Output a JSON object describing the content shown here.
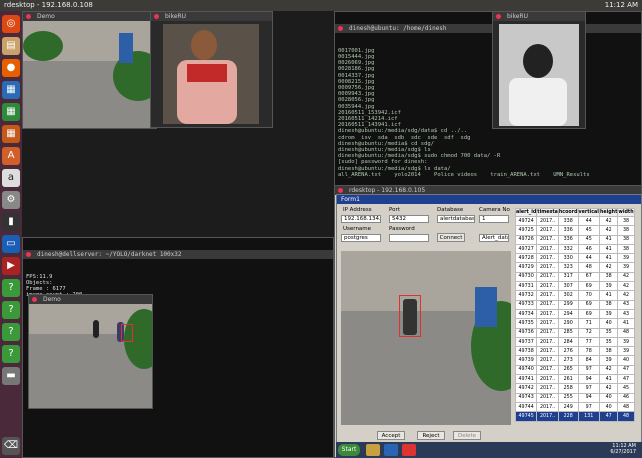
{
  "topbar": {
    "title": "rdesktop - 192.168.0.108",
    "clock": "11:12 AM"
  },
  "win_demo_top": {
    "title": "Demo"
  },
  "win_bikeru_left": {
    "title": "bikeRU"
  },
  "win_bikeru_right": {
    "title": "bikeRU"
  },
  "terminal_top_right": {
    "title": "dinesh@ubuntu: /home/dinesh",
    "lines": [
      "0017001.jpg",
      "0015444.jpg",
      "0026069.jpg",
      "0028186.jpg",
      "0014337.jpg",
      "0008215.jpg",
      "0009756.jpg",
      "0009943.jpg",
      "0028056.jpg",
      "0035944.jpg",
      "20160511_153942.icf",
      "20160511_14214.icf",
      "20160511_143941.icf",
      "dinesh@ubuntu:/media/sdg/data$ cd ../..",
      "cdrom  isv  sda  sdb  sdc  sde  sdf  sdg",
      "dinesh@ubuntu:/media$ cd sdg/",
      "dinesh@ubuntu:/media/sdg$ ls",
      "dinesh@ubuntu:/media/sdg$ sudo chmod 700 data/ -R",
      "[sudo] password for dinesh:",
      "dinesh@ubuntu:/media/sdg$ ls data/",
      "all_ARENA.txt    yolo2014    Police videos    train_ARENA.txt    UMN_Results"
    ]
  },
  "terminal_darknet": {
    "title": "dinesh@dellserver: ~/YOLO/darknet 100x32",
    "lines": [
      "FPS:11.9",
      "Objects:",
      "",
      "Frame : 6177",
      "image_count : 200"
    ]
  },
  "win_demo_bottom": {
    "title": "Demo"
  },
  "form1": {
    "window_title": "rdesktop - 192.168.0.105",
    "title": "Form1",
    "ip_label": "IP Address",
    "ip_value": "192.168.134.5",
    "port_label": "Port",
    "port_value": "5432",
    "db_label": "Database",
    "db_value": "alertdatabase",
    "camera_label": "Camera No",
    "camera_value": "1",
    "user_label": "Username",
    "user_value": "postgres",
    "pass_label": "Password",
    "pass_value": "",
    "connect_label": "Connect",
    "alert_select": "Alert_data▾",
    "accept_label": "Accept",
    "reject_label": "Reject",
    "extra_label": "Delete",
    "grid": {
      "headers": [
        "alert_id",
        "timesta",
        "hcoord",
        "vertical",
        "height",
        "width"
      ],
      "rows": [
        [
          "49724",
          "2017..",
          "338",
          "44",
          "42",
          "38"
        ],
        [
          "49725",
          "2017..",
          "336",
          "45",
          "42",
          "38"
        ],
        [
          "49726",
          "2017..",
          "336",
          "45",
          "41",
          "38"
        ],
        [
          "49727",
          "2017..",
          "332",
          "46",
          "41",
          "38"
        ],
        [
          "49728",
          "2017..",
          "330",
          "44",
          "41",
          "39"
        ],
        [
          "49729",
          "2017..",
          "323",
          "48",
          "42",
          "39"
        ],
        [
          "49730",
          "2017..",
          "317",
          "67",
          "38",
          "42"
        ],
        [
          "49731",
          "2017..",
          "307",
          "69",
          "39",
          "42"
        ],
        [
          "49732",
          "2017..",
          "302",
          "70",
          "41",
          "42"
        ],
        [
          "49733",
          "2017..",
          "299",
          "69",
          "38",
          "43"
        ],
        [
          "49734",
          "2017..",
          "294",
          "69",
          "39",
          "43"
        ],
        [
          "49735",
          "2017..",
          "290",
          "71",
          "40",
          "41"
        ],
        [
          "49736",
          "2017..",
          "285",
          "72",
          "35",
          "48"
        ],
        [
          "49737",
          "2017..",
          "284",
          "77",
          "35",
          "39"
        ],
        [
          "49738",
          "2017..",
          "276",
          "78",
          "38",
          "39"
        ],
        [
          "49739",
          "2017..",
          "273",
          "84",
          "39",
          "40"
        ],
        [
          "49740",
          "2017..",
          "265",
          "97",
          "42",
          "47"
        ],
        [
          "49741",
          "2017..",
          "261",
          "94",
          "41",
          "47"
        ],
        [
          "49742",
          "2017..",
          "258",
          "97",
          "42",
          "45"
        ],
        [
          "49743",
          "2017..",
          "255",
          "94",
          "40",
          "46"
        ],
        [
          "49744",
          "2017..",
          "249",
          "97",
          "40",
          "48"
        ],
        [
          "49745",
          "2017..",
          "228",
          "131",
          "47",
          "48"
        ]
      ]
    }
  },
  "taskbar": {
    "start": "Start",
    "time": "11:12 AM",
    "date": "6/27/2017"
  }
}
